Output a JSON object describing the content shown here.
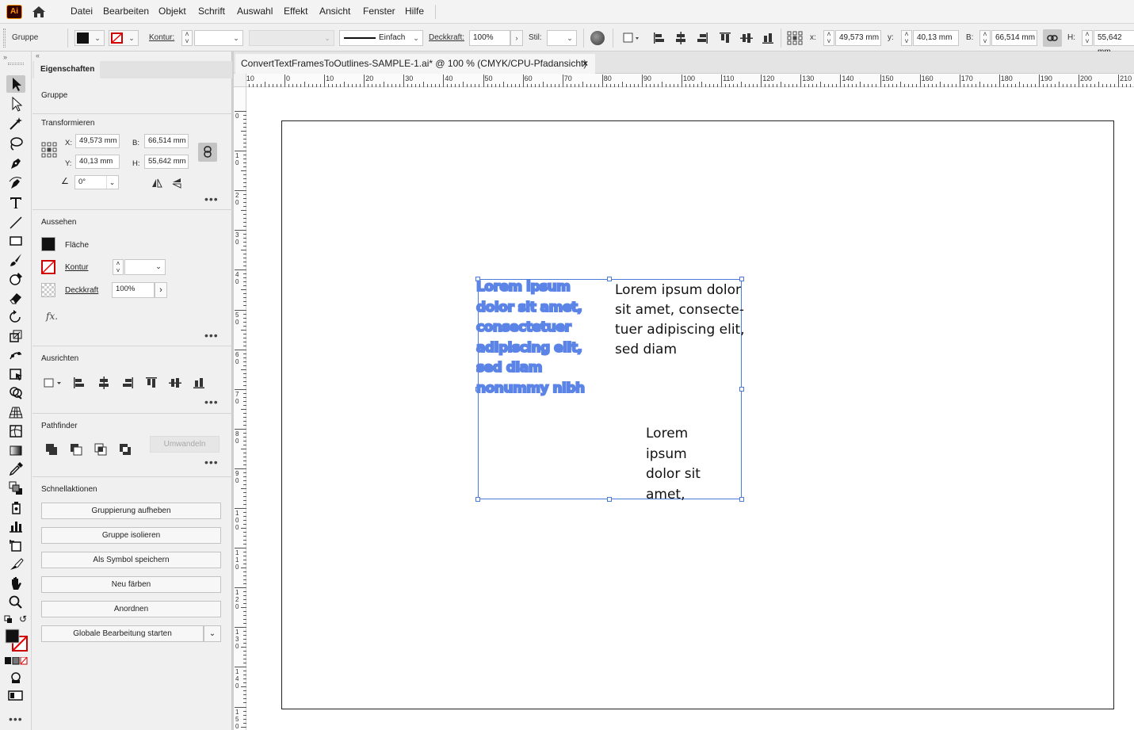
{
  "app": {
    "logo": "Ai"
  },
  "menubar": {
    "items": [
      "Datei",
      "Bearbeiten",
      "Objekt",
      "Schrift",
      "Auswahl",
      "Effekt",
      "Ansicht",
      "Fenster",
      "Hilfe"
    ]
  },
  "controlbar": {
    "selection_type": "Gruppe",
    "kontur_label": "Kontur:",
    "stroke_style": "Einfach",
    "deckkraft_label": "Deckkraft:",
    "deckkraft_value": "100%",
    "stil_label": "Stil:",
    "x_label": "x:",
    "x_value": "49,573 mm",
    "y_label": "y:",
    "y_value": "40,13 mm",
    "b_label": "B:",
    "b_value": "66,514 mm",
    "h_label": "H:",
    "h_value": "55,642 mm"
  },
  "document": {
    "tab_title": "ConvertTextFramesToOutlines-SAMPLE-1.ai* @ 100 % (CMYK/CPU-Pfadansicht)",
    "close": "×"
  },
  "ruler": {
    "h_labels": [
      "10",
      "0",
      "10",
      "20",
      "30",
      "40",
      "50",
      "60",
      "70",
      "80",
      "90",
      "100",
      "110",
      "120",
      "130",
      "140",
      "150",
      "160",
      "170",
      "180",
      "190",
      "200",
      "210"
    ],
    "v_labels": [
      "0",
      "1\n0",
      "2\n0",
      "3\n0",
      "4\n0",
      "5\n0",
      "6\n0",
      "7\n0",
      "8\n0",
      "9\n0",
      "1\n0\n0",
      "1\n1\n0",
      "1\n2\n0",
      "1\n3\n0",
      "1\n4\n0",
      "1\n5\n0"
    ]
  },
  "properties": {
    "tab": "Eigenschaften",
    "object_type": "Gruppe",
    "transform": {
      "title": "Transformieren",
      "x_label": "X:",
      "x_value": "49,573 mm",
      "y_label": "Y:",
      "y_value": "40,13 mm",
      "b_label": "B:",
      "b_value": "66,514 mm",
      "h_label": "H:",
      "h_value": "55,642 mm",
      "angle_value": "0°"
    },
    "appearance": {
      "title": "Aussehen",
      "fill_label": "Fläche",
      "stroke_label": "Kontur",
      "opacity_label": "Deckkraft",
      "opacity_value": "100%",
      "fx": "fx."
    },
    "align": {
      "title": "Ausrichten"
    },
    "pathfinder": {
      "title": "Pathfinder",
      "convert_button": "Umwandeln"
    },
    "quick_actions": {
      "title": "Schnellaktionen",
      "buttons": [
        "Gruppierung aufheben",
        "Gruppe isolieren",
        "Als Symbol speichern",
        "Neu färben",
        "Anordnen",
        "Globale Bearbeitung starten"
      ]
    }
  },
  "artwork": {
    "outlined_lines": [
      "Lorem ipsum",
      "dolor sit amet,",
      "consectetuer",
      "adipiscing elit,",
      "sed diam",
      "nonummy nibh"
    ],
    "text_frame_1": [
      "Lorem ipsum dolor",
      "sit amet, consecte-",
      "tuer adipiscing elit,",
      "sed diam"
    ],
    "text_frame_2": [
      "Lorem",
      "ipsum",
      "dolor sit",
      "amet,"
    ]
  },
  "colors": {
    "selection": "#4a7bd8",
    "outline_text": "#5b84e6",
    "accent_logo": "#ff9a00"
  }
}
